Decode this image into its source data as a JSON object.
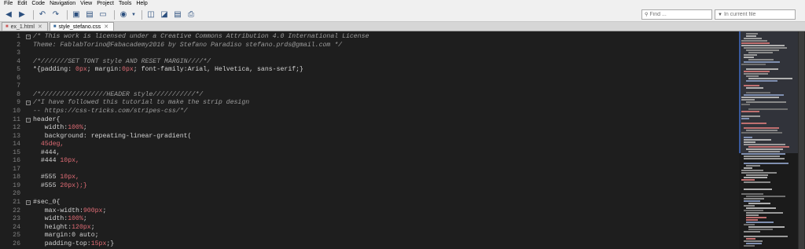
{
  "menu": [
    "File",
    "Edit",
    "Code",
    "Navigation",
    "View",
    "Project",
    "Tools",
    "Help"
  ],
  "search": {
    "find_placeholder": "Find ...",
    "scope_placeholder": "In current file"
  },
  "tabs": [
    {
      "label": "ex_1.html",
      "active": false
    },
    {
      "label": "style_stefano.css",
      "active": true
    }
  ],
  "lines": [
    {
      "n": "1",
      "fold": "−",
      "code": "/* This work is licensed under a Creative Commons Attribution 4.0 International License",
      "kind": "com"
    },
    {
      "n": "2",
      "fold": "",
      "code": "Theme: FablabTorino@Fabacademy2016 by Stefano Paradiso stefano.prds@gmail.com */",
      "kind": "com"
    },
    {
      "n": "3",
      "fold": "",
      "code": "",
      "kind": "plain"
    },
    {
      "n": "4",
      "fold": "",
      "code": "/*///////SET TONT style AND RESET MARGIN////*/",
      "kind": "com"
    },
    {
      "n": "5",
      "fold": "",
      "code": "*{padding: 0px; margin:0px; font-family:Arial, Helvetica, sans-serif;}",
      "kind": "line5"
    },
    {
      "n": "6",
      "fold": "",
      "code": "",
      "kind": "plain"
    },
    {
      "n": "7",
      "fold": "",
      "code": "",
      "kind": "plain"
    },
    {
      "n": "8",
      "fold": "",
      "code": "/*/////////////////HEADER style///////////*/",
      "kind": "com"
    },
    {
      "n": "9",
      "fold": "−",
      "code": "/*I have followed this tutorial to make the strip design",
      "kind": "com"
    },
    {
      "n": "10",
      "fold": "",
      "code": "-- https://css-tricks.com/stripes-css/*/",
      "kind": "com"
    },
    {
      "n": "11",
      "fold": "−",
      "code": "header{",
      "kind": "plain"
    },
    {
      "n": "12",
      "fold": "",
      "code": "   width:100%;",
      "kind": "prop",
      "prop": "   width:",
      "val": "100%",
      "tail": ";"
    },
    {
      "n": "13",
      "fold": "",
      "code": "   background: repeating-linear-gradient(",
      "kind": "plain"
    },
    {
      "n": "14",
      "fold": "",
      "code": "  45deg,",
      "kind": "num"
    },
    {
      "n": "15",
      "fold": "",
      "code": "  #444,",
      "kind": "plain"
    },
    {
      "n": "16",
      "fold": "",
      "code": "  #444 10px,",
      "kind": "col"
    },
    {
      "n": "17",
      "fold": "",
      "code": "",
      "kind": "plain"
    },
    {
      "n": "18",
      "fold": "",
      "code": "  #555 10px,",
      "kind": "col"
    },
    {
      "n": "19",
      "fold": "",
      "code": "  #555 20px);}",
      "kind": "col"
    },
    {
      "n": "20",
      "fold": "",
      "code": "",
      "kind": "plain"
    },
    {
      "n": "21",
      "fold": "−",
      "code": "#sec_0{",
      "kind": "plain"
    },
    {
      "n": "22",
      "fold": "",
      "code": "   max-width:900px;",
      "kind": "prop",
      "prop": "   max-width:",
      "val": "900px",
      "tail": ";"
    },
    {
      "n": "23",
      "fold": "",
      "code": "   width:100%;",
      "kind": "prop",
      "prop": "   width:",
      "val": "100%",
      "tail": ";"
    },
    {
      "n": "24",
      "fold": "",
      "code": "   height:120px;",
      "kind": "prop",
      "prop": "   height:",
      "val": "120px",
      "tail": ";"
    },
    {
      "n": "25",
      "fold": "",
      "code": "   margin:0 auto;",
      "kind": "plain"
    },
    {
      "n": "26",
      "fold": "",
      "code": "   padding-top:15px;}",
      "kind": "prop",
      "prop": "   padding-top:",
      "val": "15px",
      "tail": ";}"
    }
  ],
  "colors": {
    "editor_bg": "#1e1e1e",
    "comment": "#9d9d9d",
    "number": "#e06c75",
    "text": "#d4d4d4",
    "line_number": "#7f7f7f"
  }
}
